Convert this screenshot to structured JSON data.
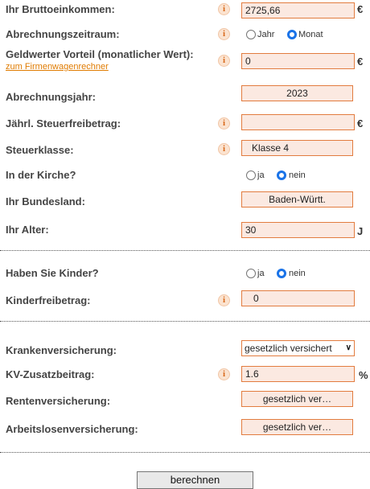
{
  "rows": {
    "brutto": {
      "label": "Ihr Bruttoeinkommen:",
      "value": "2725,66",
      "unit": "€"
    },
    "zeitraum": {
      "label": "Abrechnungszeitraum:",
      "opt1": "Jahr",
      "opt2": "Monat",
      "selected": "Monat"
    },
    "vorteil": {
      "label": "Geldwerter Vorteil (monatlicher Wert):",
      "link": "zum Firmenwagenrechner",
      "value": "0",
      "unit": "€"
    },
    "jahr": {
      "label": "Abrechnungsjahr:",
      "value": "2023"
    },
    "freibetrag": {
      "label": "Jährl. Steuerfreibetrag:",
      "value": "",
      "unit": "€"
    },
    "steuerklasse": {
      "label": "Steuerklasse:",
      "value": "Klasse 4"
    },
    "kirche": {
      "label": "In der Kirche?",
      "opt1": "ja",
      "opt2": "nein",
      "selected": "nein"
    },
    "bundesland": {
      "label": "Ihr Bundesland:",
      "value": "Baden-Württ."
    },
    "alter": {
      "label": "Ihr Alter:",
      "value": "30",
      "unit": "J"
    },
    "kinder": {
      "label": "Haben Sie Kinder?",
      "opt1": "ja",
      "opt2": "nein",
      "selected": "nein"
    },
    "kinderfreibetrag": {
      "label": "Kinderfreibetrag:",
      "value": "0"
    },
    "kv": {
      "label": "Krankenversicherung:",
      "value": "gesetzlich versichert"
    },
    "kvzusatz": {
      "label": "KV-Zusatzbeitrag:",
      "value": "1.6",
      "unit": "%"
    },
    "rv": {
      "label": "Rentenversicherung:",
      "value": "gesetzlich ver…"
    },
    "av": {
      "label": "Arbeitslosenversicherung:",
      "value": "gesetzlich ver…"
    }
  },
  "info_glyph": "i",
  "icons": {
    "info": "info-icon",
    "dropdown": "chevron-down-icon"
  },
  "colors": {
    "accent": "#e27c3f",
    "field_bg": "#fbe9e1",
    "link": "#e07b00",
    "radio": "#1a73e8"
  },
  "submit": {
    "label": "berechnen"
  }
}
